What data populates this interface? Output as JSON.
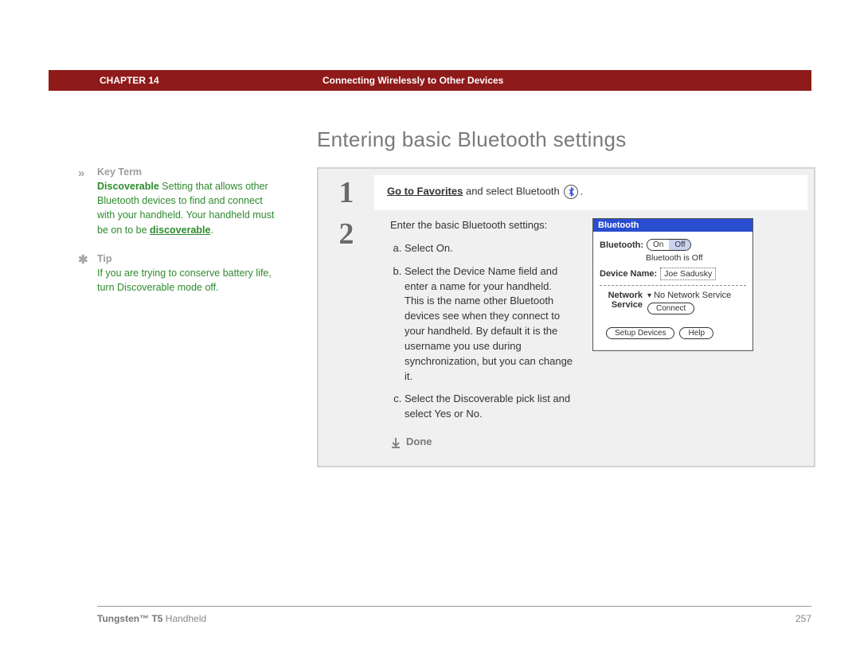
{
  "header": {
    "chapter": "CHAPTER 14",
    "title": "Connecting Wirelessly to Other Devices"
  },
  "page_title": "Entering basic Bluetooth settings",
  "sidebar": {
    "keyterm_label": "Key Term",
    "keyterm_bold": "Discoverable",
    "keyterm_text": "   Setting that allows other Bluetooth devices to find and connect with your handheld. Your handheld must be on to be ",
    "keyterm_link": "discoverable",
    "tip_label": "Tip",
    "tip_text": "If you are trying to conserve battery life, turn Discoverable mode off."
  },
  "steps": {
    "s1_num": "1",
    "s1_link": "Go to Favorites",
    "s1_rest": " and select Bluetooth ",
    "s1_period": ".",
    "s2_num": "2",
    "s2_intro": "Enter the basic Bluetooth settings:",
    "s2_a": "Select On.",
    "s2_b": "Select the Device Name field and enter a name for your handheld. This is the name other Bluetooth devices see when they connect to your handheld. By default it is the username you use during synchronization, but you can change it.",
    "s2_c": "Select the Discoverable pick list and select Yes or No.",
    "done": "Done"
  },
  "device": {
    "title": "Bluetooth",
    "bt_label": "Bluetooth:",
    "on": "On",
    "off": "Off",
    "status": "Bluetooth is Off",
    "name_label": "Device Name:",
    "name_value": "Joe Sadusky",
    "network_label": "Network Service",
    "network_value": "No Network Service",
    "connect": "Connect",
    "setup": "Setup Devices",
    "help": "Help"
  },
  "footer": {
    "product_bold": "Tungsten™ T5",
    "product_rest": " Handheld",
    "page": "257"
  }
}
